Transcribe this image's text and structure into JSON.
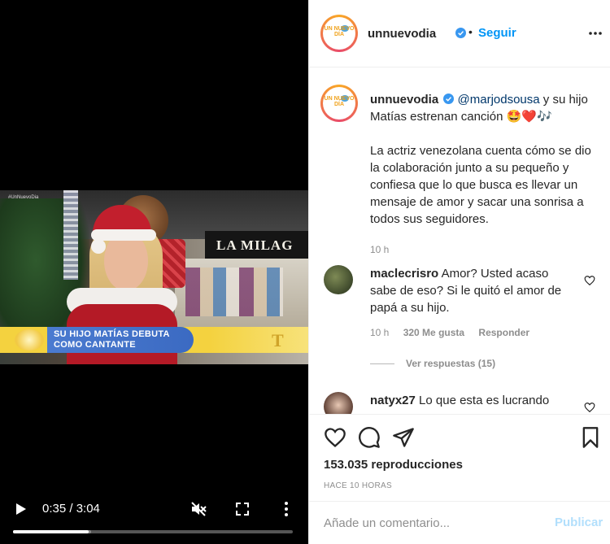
{
  "video": {
    "network_tag": "#UnNuevoDia",
    "store_sign": "LA MILAG",
    "lower_third": {
      "line1": "SU HIJO MATÍAS DEBUTA",
      "line2": "COMO CANTANTE",
      "logo": "T"
    },
    "controls": {
      "time": "0:35 / 3:04",
      "progress_fraction": 0.27,
      "buffered_fraction": 0.28
    }
  },
  "header": {
    "avatar_logo": "UN NUEVO DÍA",
    "username": "unnuevodia",
    "dot": "•",
    "follow_label": "Seguir"
  },
  "caption": {
    "username": "unnuevodia",
    "mention": "@marjodsousa",
    "text_after_mention": " y su hijo Matías estrenan canción 🤩❤️🎶",
    "paragraph": "La actriz venezolana cuenta cómo se dio la colaboración junto a su pequeño y confiesa que lo que busca es llevar un mensaje de amor y sacar una sonrisa a todos sus seguidores.",
    "time": "10 h"
  },
  "comments": [
    {
      "username": "maclecrisro",
      "text": "Amor? Usted acaso sabe de eso? Si le quitó el amor de papá a su hijo.",
      "time": "10 h",
      "likes": "320 Me gusta",
      "reply": "Responder",
      "view_replies": "Ver respuestas (15)"
    },
    {
      "username": "natyx27",
      "text": "Lo que esta es lucrando"
    }
  ],
  "stats": {
    "views_count": "153.035",
    "views_label": "reproducciones",
    "ago": "HACE 10 HORAS"
  },
  "add_comment": {
    "placeholder": "Añade un comentario...",
    "publish": "Publicar"
  },
  "colors": {
    "accent": "#0095f6",
    "publish_disabled": "#b2dffc",
    "muted": "#8e8e8e"
  }
}
